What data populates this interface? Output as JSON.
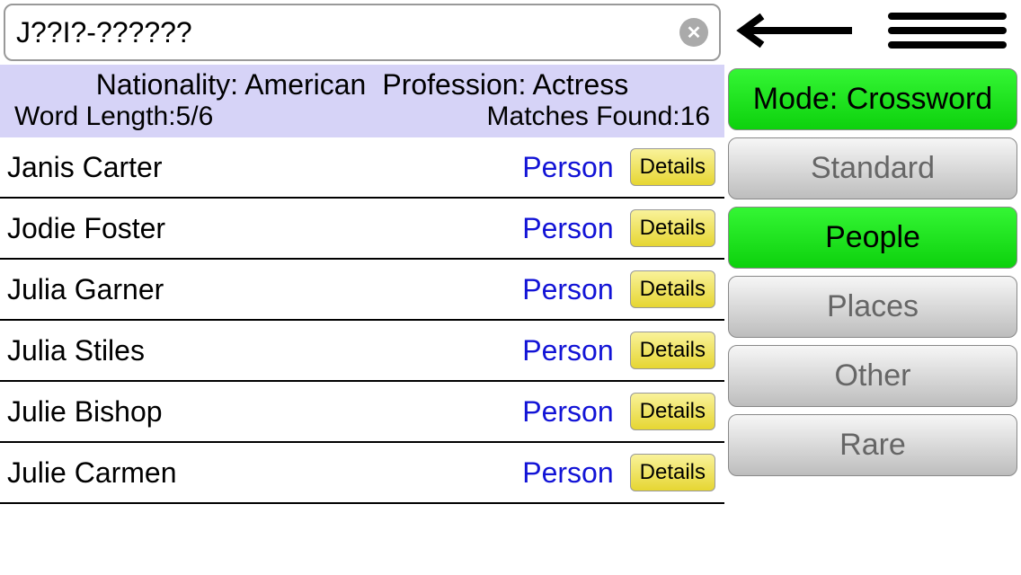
{
  "search": {
    "value": "J??I?-??????"
  },
  "filters": {
    "nationality_label": "Nationality: American",
    "profession_label": "Profession: Actress",
    "word_length_label": "Word Length:5/6",
    "matches_label": "Matches Found:16"
  },
  "results": [
    {
      "name": "Janis Carter",
      "type": "Person",
      "details": "Details"
    },
    {
      "name": "Jodie Foster",
      "type": "Person",
      "details": "Details"
    },
    {
      "name": "Julia Garner",
      "type": "Person",
      "details": "Details"
    },
    {
      "name": "Julia Stiles",
      "type": "Person",
      "details": "Details"
    },
    {
      "name": "Julie Bishop",
      "type": "Person",
      "details": "Details"
    },
    {
      "name": "Julie Carmen",
      "type": "Person",
      "details": "Details"
    }
  ],
  "sidebar": {
    "mode": "Mode: Crossword",
    "standard": "Standard",
    "people": "People",
    "places": "Places",
    "other": "Other",
    "rare": "Rare"
  }
}
